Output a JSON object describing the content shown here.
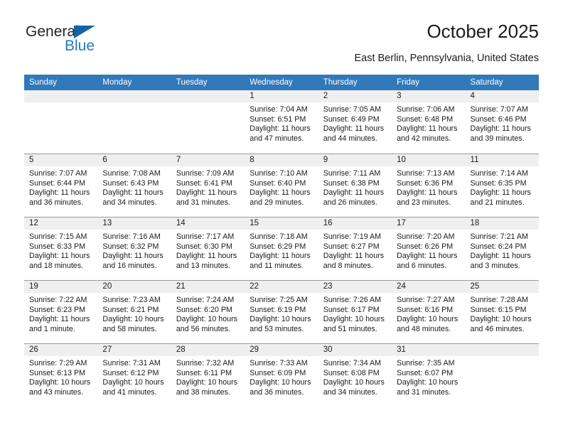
{
  "brand": {
    "name_top": "General",
    "name_bottom": "Blue",
    "triangle_color": "#1464a5",
    "blue_color": "#1f7ac4"
  },
  "header": {
    "title": "October 2025",
    "subtitle": "East Berlin, Pennsylvania, United States"
  },
  "theme": {
    "header_bar": "#3179b9",
    "daynum_band": "#efefef",
    "row_rule": "#9a9a9a",
    "text": "#1b1b1b"
  },
  "weekday_headers": [
    "Sunday",
    "Monday",
    "Tuesday",
    "Wednesday",
    "Thursday",
    "Friday",
    "Saturday"
  ],
  "weeks": [
    [
      {
        "day": "",
        "lines": []
      },
      {
        "day": "",
        "lines": []
      },
      {
        "day": "",
        "lines": []
      },
      {
        "day": "1",
        "lines": [
          "Sunrise: 7:04 AM",
          "Sunset: 6:51 PM",
          "Daylight: 11 hours",
          "and 47 minutes."
        ]
      },
      {
        "day": "2",
        "lines": [
          "Sunrise: 7:05 AM",
          "Sunset: 6:49 PM",
          "Daylight: 11 hours",
          "and 44 minutes."
        ]
      },
      {
        "day": "3",
        "lines": [
          "Sunrise: 7:06 AM",
          "Sunset: 6:48 PM",
          "Daylight: 11 hours",
          "and 42 minutes."
        ]
      },
      {
        "day": "4",
        "lines": [
          "Sunrise: 7:07 AM",
          "Sunset: 6:46 PM",
          "Daylight: 11 hours",
          "and 39 minutes."
        ]
      }
    ],
    [
      {
        "day": "5",
        "lines": [
          "Sunrise: 7:07 AM",
          "Sunset: 6:44 PM",
          "Daylight: 11 hours",
          "and 36 minutes."
        ]
      },
      {
        "day": "6",
        "lines": [
          "Sunrise: 7:08 AM",
          "Sunset: 6:43 PM",
          "Daylight: 11 hours",
          "and 34 minutes."
        ]
      },
      {
        "day": "7",
        "lines": [
          "Sunrise: 7:09 AM",
          "Sunset: 6:41 PM",
          "Daylight: 11 hours",
          "and 31 minutes."
        ]
      },
      {
        "day": "8",
        "lines": [
          "Sunrise: 7:10 AM",
          "Sunset: 6:40 PM",
          "Daylight: 11 hours",
          "and 29 minutes."
        ]
      },
      {
        "day": "9",
        "lines": [
          "Sunrise: 7:11 AM",
          "Sunset: 6:38 PM",
          "Daylight: 11 hours",
          "and 26 minutes."
        ]
      },
      {
        "day": "10",
        "lines": [
          "Sunrise: 7:13 AM",
          "Sunset: 6:36 PM",
          "Daylight: 11 hours",
          "and 23 minutes."
        ]
      },
      {
        "day": "11",
        "lines": [
          "Sunrise: 7:14 AM",
          "Sunset: 6:35 PM",
          "Daylight: 11 hours",
          "and 21 minutes."
        ]
      }
    ],
    [
      {
        "day": "12",
        "lines": [
          "Sunrise: 7:15 AM",
          "Sunset: 6:33 PM",
          "Daylight: 11 hours",
          "and 18 minutes."
        ]
      },
      {
        "day": "13",
        "lines": [
          "Sunrise: 7:16 AM",
          "Sunset: 6:32 PM",
          "Daylight: 11 hours",
          "and 16 minutes."
        ]
      },
      {
        "day": "14",
        "lines": [
          "Sunrise: 7:17 AM",
          "Sunset: 6:30 PM",
          "Daylight: 11 hours",
          "and 13 minutes."
        ]
      },
      {
        "day": "15",
        "lines": [
          "Sunrise: 7:18 AM",
          "Sunset: 6:29 PM",
          "Daylight: 11 hours",
          "and 11 minutes."
        ]
      },
      {
        "day": "16",
        "lines": [
          "Sunrise: 7:19 AM",
          "Sunset: 6:27 PM",
          "Daylight: 11 hours",
          "and 8 minutes."
        ]
      },
      {
        "day": "17",
        "lines": [
          "Sunrise: 7:20 AM",
          "Sunset: 6:26 PM",
          "Daylight: 11 hours",
          "and 6 minutes."
        ]
      },
      {
        "day": "18",
        "lines": [
          "Sunrise: 7:21 AM",
          "Sunset: 6:24 PM",
          "Daylight: 11 hours",
          "and 3 minutes."
        ]
      }
    ],
    [
      {
        "day": "19",
        "lines": [
          "Sunrise: 7:22 AM",
          "Sunset: 6:23 PM",
          "Daylight: 11 hours",
          "and 1 minute."
        ]
      },
      {
        "day": "20",
        "lines": [
          "Sunrise: 7:23 AM",
          "Sunset: 6:21 PM",
          "Daylight: 10 hours",
          "and 58 minutes."
        ]
      },
      {
        "day": "21",
        "lines": [
          "Sunrise: 7:24 AM",
          "Sunset: 6:20 PM",
          "Daylight: 10 hours",
          "and 56 minutes."
        ]
      },
      {
        "day": "22",
        "lines": [
          "Sunrise: 7:25 AM",
          "Sunset: 6:19 PM",
          "Daylight: 10 hours",
          "and 53 minutes."
        ]
      },
      {
        "day": "23",
        "lines": [
          "Sunrise: 7:26 AM",
          "Sunset: 6:17 PM",
          "Daylight: 10 hours",
          "and 51 minutes."
        ]
      },
      {
        "day": "24",
        "lines": [
          "Sunrise: 7:27 AM",
          "Sunset: 6:16 PM",
          "Daylight: 10 hours",
          "and 48 minutes."
        ]
      },
      {
        "day": "25",
        "lines": [
          "Sunrise: 7:28 AM",
          "Sunset: 6:15 PM",
          "Daylight: 10 hours",
          "and 46 minutes."
        ]
      }
    ],
    [
      {
        "day": "26",
        "lines": [
          "Sunrise: 7:29 AM",
          "Sunset: 6:13 PM",
          "Daylight: 10 hours",
          "and 43 minutes."
        ]
      },
      {
        "day": "27",
        "lines": [
          "Sunrise: 7:31 AM",
          "Sunset: 6:12 PM",
          "Daylight: 10 hours",
          "and 41 minutes."
        ]
      },
      {
        "day": "28",
        "lines": [
          "Sunrise: 7:32 AM",
          "Sunset: 6:11 PM",
          "Daylight: 10 hours",
          "and 38 minutes."
        ]
      },
      {
        "day": "29",
        "lines": [
          "Sunrise: 7:33 AM",
          "Sunset: 6:09 PM",
          "Daylight: 10 hours",
          "and 36 minutes."
        ]
      },
      {
        "day": "30",
        "lines": [
          "Sunrise: 7:34 AM",
          "Sunset: 6:08 PM",
          "Daylight: 10 hours",
          "and 34 minutes."
        ]
      },
      {
        "day": "31",
        "lines": [
          "Sunrise: 7:35 AM",
          "Sunset: 6:07 PM",
          "Daylight: 10 hours",
          "and 31 minutes."
        ]
      },
      {
        "day": "",
        "lines": []
      }
    ]
  ]
}
